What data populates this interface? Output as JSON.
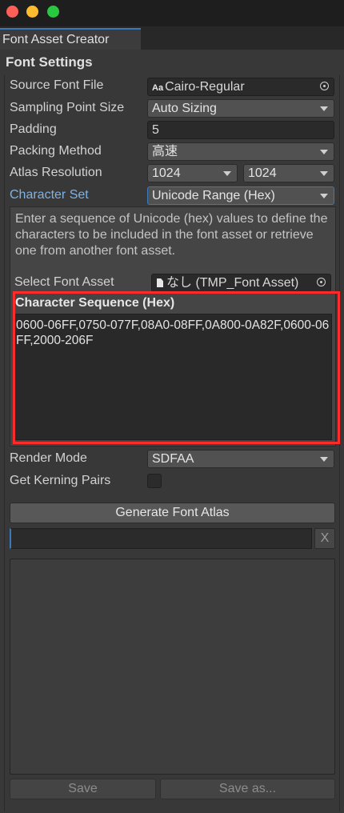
{
  "window": {
    "tab_title": "Font Asset Creator"
  },
  "font_settings": {
    "section_title": "Font Settings",
    "source_font_file": {
      "label": "Source Font File",
      "icon_text": "Aa",
      "value": "Cairo-Regular"
    },
    "sampling_point_size": {
      "label": "Sampling Point Size",
      "value": "Auto Sizing"
    },
    "padding": {
      "label": "Padding",
      "value": "5"
    },
    "packing_method": {
      "label": "Packing Method",
      "value": "高速"
    },
    "atlas_resolution": {
      "label": "Atlas Resolution",
      "width": "1024",
      "height": "1024"
    },
    "character_set": {
      "label": "Character Set",
      "value": "Unicode Range (Hex)"
    },
    "help_text": "Enter a sequence of Unicode (hex) values to define the characters to be included in the font asset or retrieve one from another font asset.",
    "select_font_asset": {
      "label": "Select Font Asset",
      "value": "なし (TMP_Font Asset)"
    },
    "character_sequence": {
      "title": "Character Sequence (Hex)",
      "value": "0600-06FF,0750-077F,08A0-08FF,0A800-0A82F,0600-06FF,2000-206F"
    },
    "render_mode": {
      "label": "Render Mode",
      "value": "SDFAA"
    },
    "get_kerning_pairs": {
      "label": "Get Kerning Pairs",
      "checked": false
    }
  },
  "actions": {
    "generate_label": "Generate Font Atlas",
    "clear_label": "X",
    "save_label": "Save",
    "save_as_label": "Save as..."
  },
  "colors": {
    "accent": "#3a79bb",
    "highlight_box": "#ff2b2b"
  }
}
